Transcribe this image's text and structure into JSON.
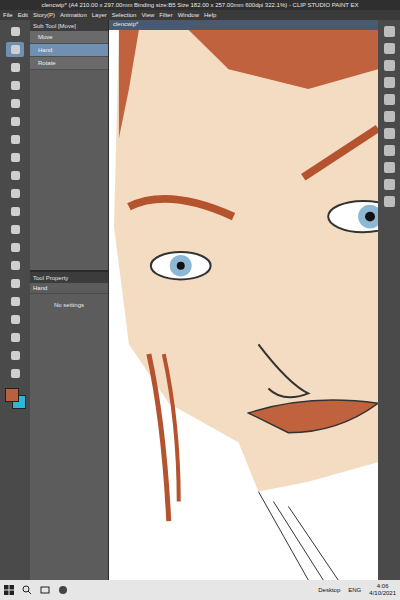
{
  "window": {
    "title": "clencwip* (A4 210.00 x 297.00mm Binding size:B5 Size 182.00 x 257.00mm 600dpi 322.1%) - CLIP STUDIO PAINT EX"
  },
  "menu": [
    "File",
    "Edit",
    "Story(P)",
    "Animation",
    "Layer",
    "Selection",
    "View",
    "Filter",
    "Window",
    "Help"
  ],
  "toolbar": [
    {
      "selected": false
    },
    {
      "selected": true
    },
    {
      "selected": false
    },
    {
      "selected": false
    },
    {
      "selected": false
    },
    {
      "selected": false
    },
    {
      "selected": false
    },
    {
      "selected": false
    },
    {
      "selected": false
    },
    {
      "selected": false
    },
    {
      "selected": false
    },
    {
      "selected": false
    },
    {
      "selected": false
    },
    {
      "selected": false
    },
    {
      "selected": false
    },
    {
      "selected": false
    },
    {
      "selected": false
    },
    {
      "selected": false
    },
    {
      "selected": false
    },
    {
      "selected": false
    }
  ],
  "color_swatches": [
    {
      "color": "#b8613f"
    },
    {
      "color": "#2bb7d9"
    }
  ],
  "sub_tool": {
    "title": "Sub Tool [Move]",
    "items": [
      {
        "label": "Move",
        "selected": false
      },
      {
        "label": "Hand",
        "selected": true
      },
      {
        "label": "Rotate",
        "selected": false
      }
    ]
  },
  "tool_property": {
    "title": "Tool Property",
    "tool": "Hand",
    "message": "No settings"
  },
  "canvas_tab": "clencwip*",
  "taskbar": {
    "desktop": "Desktop",
    "language": "ENG",
    "time": "4:06",
    "date": "4/10/2021"
  }
}
